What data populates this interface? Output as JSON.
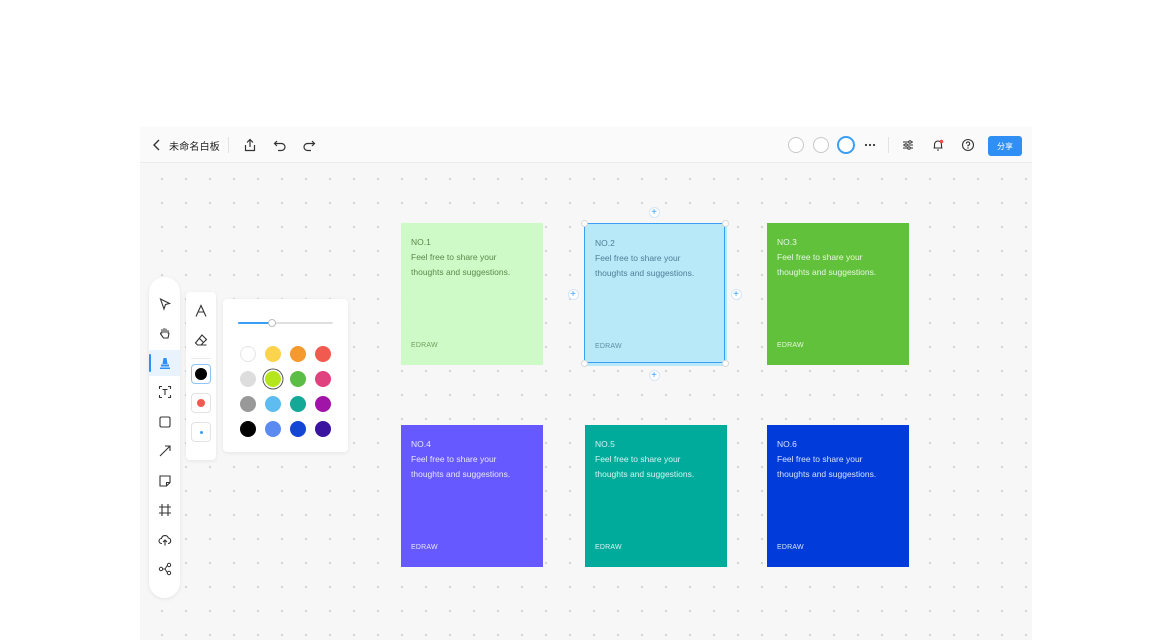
{
  "header": {
    "back_icon": "chevron-left-icon",
    "title": "未命名白板",
    "share_label": "分享",
    "accent": "#2f8ff5"
  },
  "toolbar": {
    "tools": [
      "select-arrow-icon",
      "hand-pan-icon",
      "pen-icon",
      "text-frame-icon",
      "rectangle-icon",
      "line-arrow-icon",
      "sticky-note-icon",
      "frame-icon",
      "upload-cloud-icon",
      "mind-map-icon"
    ],
    "active_tool": "pen-icon"
  },
  "pen_panel": {
    "tools": [
      "pen-tip-icon",
      "eraser-icon"
    ],
    "selected_color": "#000000",
    "alt_color": "#f05a4f",
    "brush_dot_color": "#3b9ef5"
  },
  "color_panel": {
    "stroke_width_fraction": 0.36,
    "colors": [
      [
        "#ffffff",
        "#fcd34d",
        "#f59a2e",
        "#f05a4f"
      ],
      [
        "#dddddd",
        "#b5e61d",
        "#5bbd45",
        "#e0417f"
      ],
      [
        "#999999",
        "#5ebcf0",
        "#14a896",
        "#a014a8"
      ],
      [
        "#000000",
        "#5b8bf0",
        "#1446d6",
        "#3a139e"
      ]
    ],
    "selected": "#b5e61d"
  },
  "notes": [
    {
      "no": "NO.1",
      "text": "Feel free to share your thoughts and suggestions.",
      "brand": "EDRAW",
      "color": "#cdfac7"
    },
    {
      "no": "NO.2",
      "text": "Feel free to share your thoughts and suggestions.",
      "brand": "EDRAW",
      "color": "#b7e9f8"
    },
    {
      "no": "NO.3",
      "text": "Feel free to share your thoughts and suggestions.",
      "brand": "EDRAW",
      "color": "#62c13a"
    },
    {
      "no": "NO.4",
      "text": "Feel free to share your thoughts and suggestions.",
      "brand": "EDRAW",
      "color": "#6659ff"
    },
    {
      "no": "NO.5",
      "text": "Feel free to share your thoughts and suggestions.",
      "brand": "EDRAW",
      "color": "#00ab9b"
    },
    {
      "no": "NO.6",
      "text": "Feel free to share your thoughts and suggestions.",
      "brand": "EDRAW",
      "color": "#013cdb"
    }
  ],
  "selected_note": "NO.2"
}
